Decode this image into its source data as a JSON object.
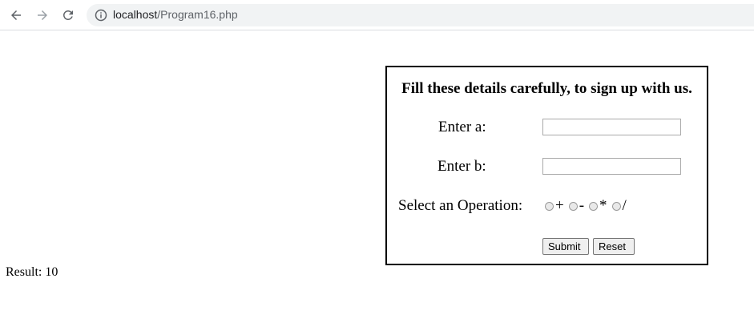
{
  "browser": {
    "url_host": "localhost",
    "url_path": "/Program16.php"
  },
  "form": {
    "title": "Fill these details carefully, to sign up with us.",
    "label_a": "Enter a:",
    "label_b": "Enter b:",
    "value_a": "",
    "value_b": "",
    "label_operation": "Select an Operation:",
    "operations": [
      "+",
      "-",
      "*",
      "/"
    ],
    "submit_label": "Submit",
    "reset_label": "Reset"
  },
  "result": {
    "text": "Result: 10"
  }
}
